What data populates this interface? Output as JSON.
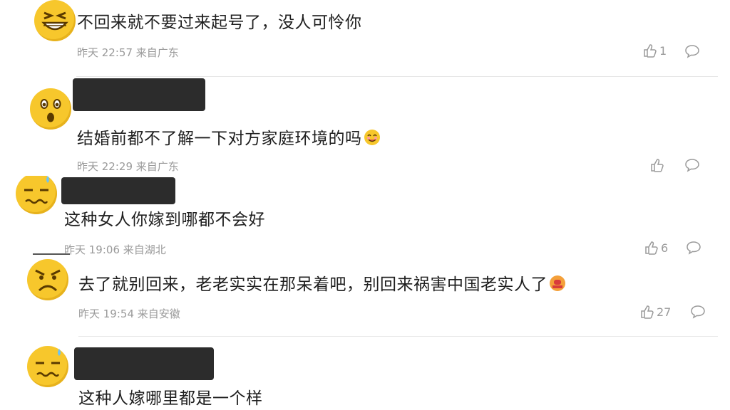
{
  "comments": [
    {
      "text": "不回来就不要过来起号了，没人可怜你",
      "time": "昨天 22:57 来自广东",
      "likes": "1",
      "avatar_icon": "grinning-emoji-icon"
    },
    {
      "text": "结婚前都不了解一下对方家庭环境的吗",
      "time": "昨天 22:29 来自广东",
      "likes": "",
      "avatar_icon": "surprised-emoji-icon",
      "trailing_emoji": "drooling-emoji-icon"
    },
    {
      "text": "这种女人你嫁到哪都不会好",
      "time": "昨天 19:06 来自湖北",
      "likes": "6",
      "avatar_icon": "sweat-emoji-icon"
    },
    {
      "text": "去了就别回来，老老实实在那呆着吧，别回来祸害中国老实人了",
      "time": "昨天 19:54 来自安徽",
      "likes": "27",
      "avatar_icon": "angry-emoji-icon",
      "trailing_emoji": "pray-emoji-icon"
    },
    {
      "text": "这种人嫁哪里都是一个样",
      "time": "",
      "likes": "",
      "avatar_icon": "sweat-emoji-icon"
    }
  ],
  "colors": {
    "avatar": "#f7c72c",
    "text": "#1f1f1f",
    "meta": "#9a9a9a",
    "mask": "#2c2c2c"
  }
}
